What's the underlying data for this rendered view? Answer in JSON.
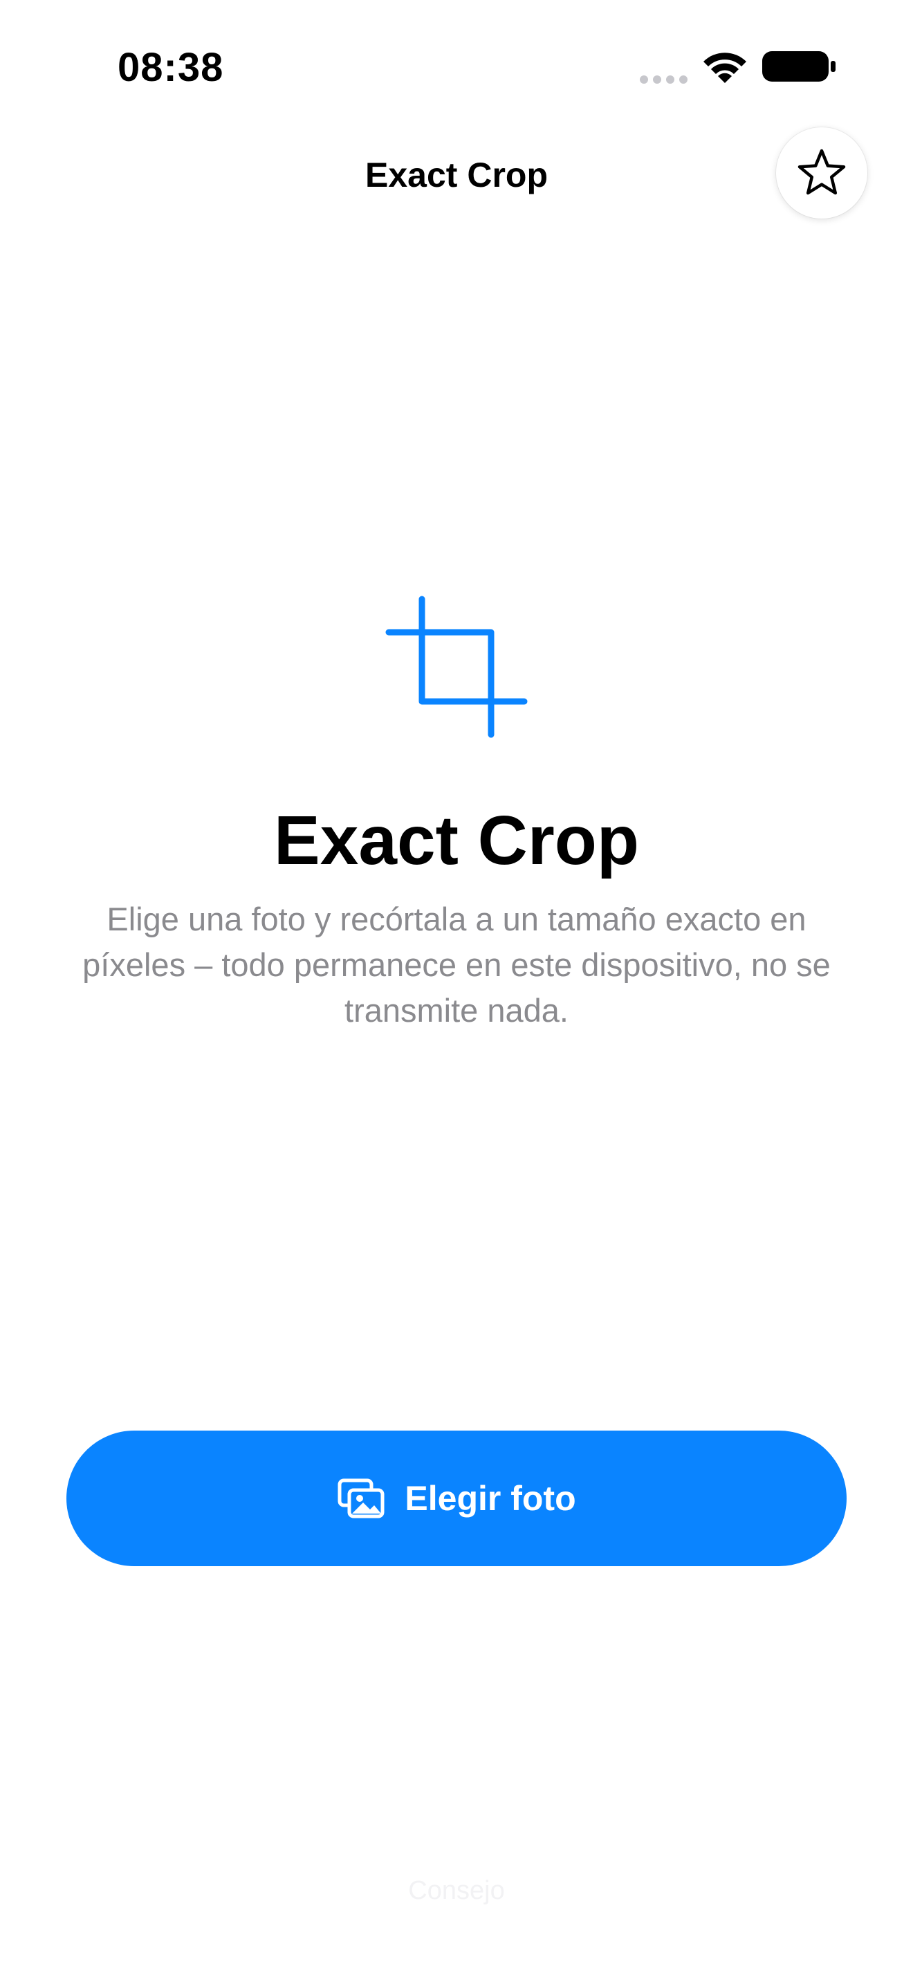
{
  "status_bar": {
    "time": "08:38",
    "icons": [
      "signal-dots-icon",
      "wifi-icon",
      "battery-icon"
    ]
  },
  "nav": {
    "title": "Exact Crop",
    "favorite_icon": "star-icon"
  },
  "hero": {
    "icon": "crop-icon",
    "title": "Exact Crop",
    "description": "Elige una foto y recórtala a un tamaño exacto en píxeles – todo permanece en este dispositivo, no se transmite nada."
  },
  "actions": {
    "choose_photo_label": "Elegir foto",
    "choose_photo_icon": "photo-stack-icon"
  },
  "footer": {
    "hint": "Consejo"
  },
  "colors": {
    "accent": "#0a84ff",
    "secondary_text": "#8a8a8e",
    "background": "#ffffff"
  }
}
